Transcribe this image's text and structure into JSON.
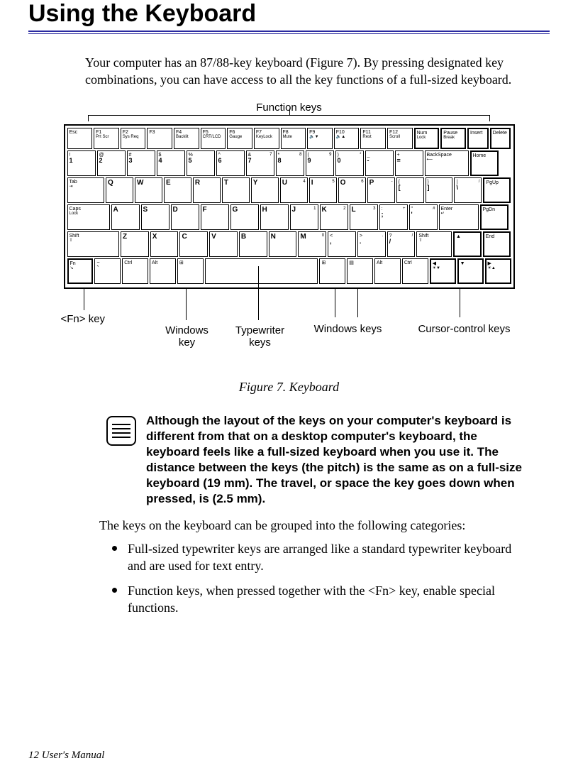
{
  "title": "Using the Keyboard",
  "intro": "Your computer has an 87/88-key keyboard (Figure 7). By pressing designated key combinations, you can have access to all the key functions of a full-sized keyboard.",
  "labels": {
    "function_keys": "Function keys",
    "fn_key": "<Fn> key",
    "windows_key": "Windows key",
    "typewriter_keys": "Typewriter keys",
    "windows_keys": "Windows keys",
    "cursor_keys": "Cursor-control keys"
  },
  "figure_caption": "Figure 7.  Keyboard",
  "note": "Although the layout of the keys on your computer's keyboard is different from that on a desktop computer's keyboard, the keyboard feels like a full-sized keyboard when you use it. The distance between the keys (the pitch) is the same as on a full-size keyboard (19 mm). The travel, or space the key goes down when pressed, is (2.5 mm).",
  "group_intro": "The keys on the keyboard can be grouped into the following categories:",
  "bullets": [
    "Full-sized typewriter keys are arranged like a standard typewriter keyboard and are used for text entry.",
    "Function keys, when pressed together with the <Fn> key, enable special functions."
  ],
  "footer": "12 User's Manual",
  "kbd": {
    "row0": [
      {
        "t": "Esc"
      },
      {
        "t": "F1",
        "s": "Prt Scr"
      },
      {
        "t": "F2",
        "s": "Sys Req"
      },
      {
        "t": "F3",
        "s": ""
      },
      {
        "t": "F4",
        "s": "Backlit"
      },
      {
        "t": "F5",
        "s": "CRT/LCD"
      },
      {
        "t": "F6",
        "s": "Gauge"
      },
      {
        "t": "F7",
        "s": "KeyLock"
      },
      {
        "t": "F8",
        "s": "Mute"
      },
      {
        "t": "F9",
        "s": "🔈▼"
      },
      {
        "t": "F10",
        "s": "🔈▲"
      },
      {
        "t": "F11",
        "s": "Rest"
      },
      {
        "t": "F12",
        "s": "Scroll"
      },
      {
        "t": "Num",
        "s": "Lock"
      },
      {
        "t": "Pause",
        "s": "Break"
      },
      {
        "t": "Insert"
      },
      {
        "t": "Delete"
      }
    ],
    "row1": [
      {
        "u": "!",
        "l": "1"
      },
      {
        "u": "@",
        "l": "2"
      },
      {
        "u": "#",
        "l": "3"
      },
      {
        "u": "$",
        "l": "4"
      },
      {
        "u": "%",
        "l": "5"
      },
      {
        "u": "^",
        "l": "6"
      },
      {
        "u": "&",
        "l": "7",
        "c": "7"
      },
      {
        "u": "*",
        "l": "8",
        "c": "8"
      },
      {
        "u": "(",
        "l": "9",
        "c": "9"
      },
      {
        "u": ")",
        "l": "0",
        "c": "*"
      },
      {
        "u": "_",
        "l": "-"
      },
      {
        "u": "+",
        "l": "="
      },
      {
        "t": "BackSpace",
        "s": "⟵"
      },
      {
        "t": "Home"
      }
    ],
    "row2": [
      {
        "t": "Tab",
        "s": "⇥"
      },
      {
        "m": "Q"
      },
      {
        "m": "W"
      },
      {
        "m": "E"
      },
      {
        "m": "R"
      },
      {
        "m": "T"
      },
      {
        "m": "Y"
      },
      {
        "m": "U",
        "c": "4"
      },
      {
        "m": "I",
        "c": "5"
      },
      {
        "m": "O",
        "c": "6"
      },
      {
        "m": "P",
        "c": "-"
      },
      {
        "u": "{",
        "l": "["
      },
      {
        "u": "}",
        "l": "]"
      },
      {
        "u": "|",
        "l": "\\",
        "c": "/"
      },
      {
        "t": "PgUp"
      }
    ],
    "row3": [
      {
        "t": "Caps",
        "s": "Lock"
      },
      {
        "m": "A"
      },
      {
        "m": "S"
      },
      {
        "m": "D"
      },
      {
        "m": "F"
      },
      {
        "m": "G"
      },
      {
        "m": "H"
      },
      {
        "m": "J",
        "c": "1"
      },
      {
        "m": "K",
        "c": "2"
      },
      {
        "m": "L",
        "c": "3"
      },
      {
        "u": ":",
        "l": ";",
        "c": "+"
      },
      {
        "u": "\"",
        "l": "'",
        "c": "#"
      },
      {
        "t": "Enter",
        "s": "↵"
      },
      {
        "t": "PgDn"
      }
    ],
    "row4": [
      {
        "t": "Shift",
        "s": "⇧"
      },
      {
        "m": "Z"
      },
      {
        "m": "X"
      },
      {
        "m": "C"
      },
      {
        "m": "V"
      },
      {
        "m": "B"
      },
      {
        "m": "N"
      },
      {
        "m": "M",
        "c": "0"
      },
      {
        "u": "<",
        "l": ","
      },
      {
        "u": ">",
        "l": ".",
        "c": "."
      },
      {
        "u": "?",
        "l": "/",
        "c": "/"
      },
      {
        "t": "Shift",
        "s": "⇧"
      },
      {
        "t": "▲"
      },
      {
        "t": "End"
      }
    ],
    "row5": [
      {
        "t": "Fn",
        "s": "↘"
      },
      {
        "u": "~",
        "l": "`"
      },
      {
        "t": "Ctrl"
      },
      {
        "t": "Alt"
      },
      {
        "t": "⊞"
      },
      {
        "t": ""
      },
      {
        "t": "⊞"
      },
      {
        "t": "▤"
      },
      {
        "t": "Alt"
      },
      {
        "t": "Ctrl"
      },
      {
        "t": "◀",
        "s": "☀▼"
      },
      {
        "t": "▼"
      },
      {
        "t": "▶",
        "s": "☀▲"
      }
    ]
  }
}
